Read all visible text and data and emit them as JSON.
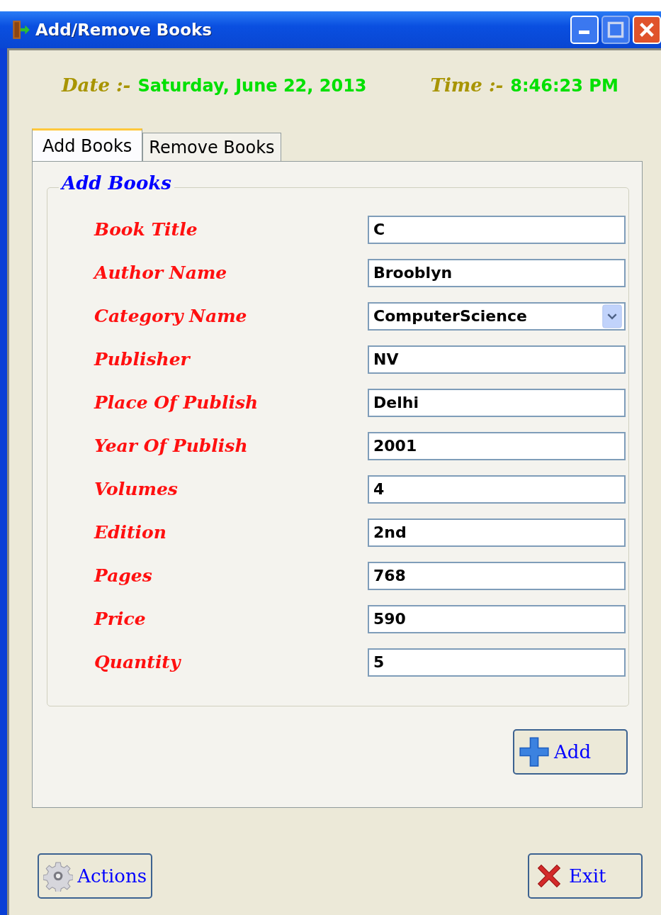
{
  "window": {
    "title": "Add/Remove Books"
  },
  "date_label": "Date :-",
  "date": "Saturday, June 22, 2013",
  "time_label": "Time :-",
  "time": "8:46:23 PM",
  "tabs": [
    {
      "label": "Add Books",
      "selected": true
    },
    {
      "label": "Remove Books",
      "selected": false
    }
  ],
  "group": {
    "title": "Add Books"
  },
  "fields": [
    {
      "label": "Book Title",
      "kind": "text",
      "value": "C"
    },
    {
      "label": "Author Name",
      "kind": "text",
      "value": "Brooblyn"
    },
    {
      "label": "Category Name",
      "kind": "dropdown",
      "value": "ComputerScience"
    },
    {
      "label": "Publisher",
      "kind": "text",
      "value": "NV"
    },
    {
      "label": "Place Of Publish",
      "kind": "text",
      "value": "Delhi"
    },
    {
      "label": "Year Of Publish",
      "kind": "text",
      "value": "2001"
    },
    {
      "label": "Volumes",
      "kind": "text",
      "value": "4"
    },
    {
      "label": "Edition",
      "kind": "text",
      "value": "2nd"
    },
    {
      "label": "Pages",
      "kind": "text",
      "value": "768"
    },
    {
      "label": "Price",
      "kind": "text",
      "value": "590"
    },
    {
      "label": "Quantity",
      "kind": "text",
      "value": "5"
    }
  ],
  "add_button": "Add",
  "buttons": [
    {
      "label": "Actions",
      "kind": "gear"
    },
    {
      "label": "Exit",
      "kind": "cross"
    }
  ]
}
